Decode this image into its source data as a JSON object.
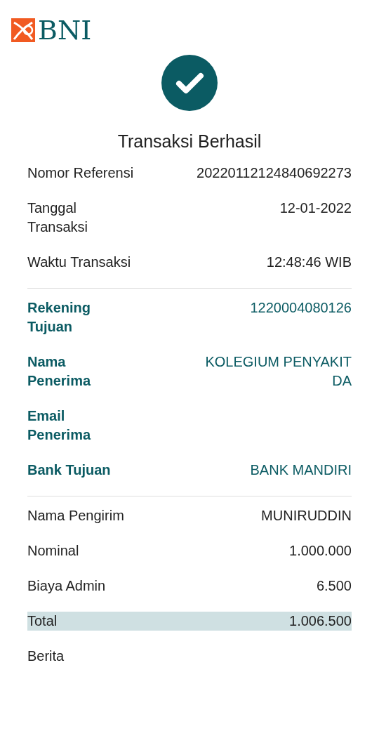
{
  "logo": {
    "text": "BNI"
  },
  "title": "Transaksi Berhasil",
  "sections": [
    {
      "kind": "dark",
      "rows": [
        {
          "label": "Nomor Referensi",
          "value": "20220112124840692273",
          "highlighted": false
        },
        {
          "label": "Tanggal Transaksi",
          "value": "12-01-2022",
          "highlighted": false
        },
        {
          "label": "Waktu Transaksi",
          "value": "12:48:46 WIB",
          "highlighted": false
        }
      ]
    },
    {
      "kind": "teal",
      "rows": [
        {
          "label": "Rekening Tujuan",
          "value": "1220004080126",
          "highlighted": false
        },
        {
          "label": "Nama Penerima",
          "value": "KOLEGIUM PENYAKIT DA",
          "highlighted": false
        },
        {
          "label": "Email Penerima",
          "highlighted": false
        },
        {
          "label": "Bank Tujuan",
          "value": "BANK MANDIRI",
          "highlighted": false
        }
      ]
    },
    {
      "kind": "dark",
      "rows": [
        {
          "label": "Nama Pengirim",
          "value": "MUNIRUDDIN",
          "highlighted": false
        },
        {
          "label": "Nominal",
          "value": "1.000.000",
          "highlighted": false
        },
        {
          "label": "Biaya Admin",
          "value": "6.500",
          "highlighted": false
        },
        {
          "label": "Total",
          "value": "1.006.500",
          "highlighted": true
        },
        {
          "label": "Berita",
          "highlighted": false
        }
      ]
    }
  ]
}
